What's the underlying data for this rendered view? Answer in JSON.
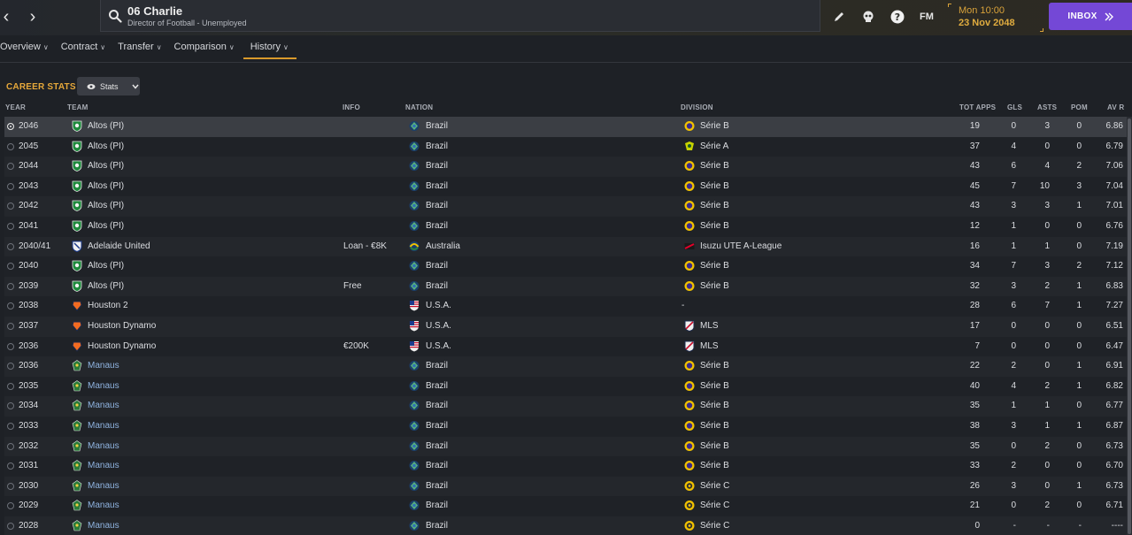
{
  "header": {
    "person_name": "06 Charlie",
    "person_role": "Director of Football - Unemployed",
    "time": "Mon 10:00",
    "date": "23 Nov 2048",
    "inbox_label": "INBOX",
    "fm_label": "FM"
  },
  "tabs": [
    {
      "label": "Overview"
    },
    {
      "label": "Contract"
    },
    {
      "label": "Transfer"
    },
    {
      "label": "Comparison"
    },
    {
      "label": "History",
      "active": true
    }
  ],
  "section": {
    "title": "CAREER STATS",
    "stats_button": "Stats"
  },
  "columns": {
    "year": "YEAR",
    "team": "TEAM",
    "info": "INFO",
    "nation": "NATION",
    "division": "DIVISION",
    "apps": "TOT APPS",
    "gls": "GLS",
    "asts": "ASTS",
    "pom": "POM",
    "avr": "AV R"
  },
  "colors": {
    "accent": "#e6a83a",
    "inbox": "#7448d6",
    "link": "#8fb3e0"
  },
  "rows": [
    {
      "year": "2046",
      "team": "Altos (PI)",
      "info": "",
      "nation": "Brazil",
      "division": "Série B",
      "apps": "19",
      "gls": "0",
      "asts": "3",
      "pom": "0",
      "avr": "6.86",
      "selected": true,
      "team_icon": "altos",
      "nation_icon": "brazil",
      "div_icon": "serie-b"
    },
    {
      "year": "2045",
      "team": "Altos (PI)",
      "info": "",
      "nation": "Brazil",
      "division": "Série A",
      "apps": "37",
      "gls": "4",
      "asts": "0",
      "pom": "0",
      "avr": "6.79",
      "team_icon": "altos",
      "nation_icon": "brazil",
      "div_icon": "serie-a"
    },
    {
      "year": "2044",
      "team": "Altos (PI)",
      "info": "",
      "nation": "Brazil",
      "division": "Série B",
      "apps": "43",
      "gls": "6",
      "asts": "4",
      "pom": "2",
      "avr": "7.06",
      "team_icon": "altos",
      "nation_icon": "brazil",
      "div_icon": "serie-b"
    },
    {
      "year": "2043",
      "team": "Altos (PI)",
      "info": "",
      "nation": "Brazil",
      "division": "Série B",
      "apps": "45",
      "gls": "7",
      "asts": "10",
      "pom": "3",
      "avr": "7.04",
      "team_icon": "altos",
      "nation_icon": "brazil",
      "div_icon": "serie-b"
    },
    {
      "year": "2042",
      "team": "Altos (PI)",
      "info": "",
      "nation": "Brazil",
      "division": "Série B",
      "apps": "43",
      "gls": "3",
      "asts": "3",
      "pom": "1",
      "avr": "7.01",
      "team_icon": "altos",
      "nation_icon": "brazil",
      "div_icon": "serie-b"
    },
    {
      "year": "2041",
      "team": "Altos (PI)",
      "info": "",
      "nation": "Brazil",
      "division": "Série B",
      "apps": "12",
      "gls": "1",
      "asts": "0",
      "pom": "0",
      "avr": "6.76",
      "team_icon": "altos",
      "nation_icon": "brazil",
      "div_icon": "serie-b"
    },
    {
      "year": "2040/41",
      "team": "Adelaide United",
      "info": "Loan - €8K",
      "nation": "Australia",
      "division": "Isuzu UTE A-League",
      "apps": "16",
      "gls": "1",
      "asts": "1",
      "pom": "0",
      "avr": "7.19",
      "team_icon": "adelaide",
      "nation_icon": "australia",
      "div_icon": "a-league"
    },
    {
      "year": "2040",
      "team": "Altos (PI)",
      "info": "",
      "nation": "Brazil",
      "division": "Série B",
      "apps": "34",
      "gls": "7",
      "asts": "3",
      "pom": "2",
      "avr": "7.12",
      "team_icon": "altos",
      "nation_icon": "brazil",
      "div_icon": "serie-b"
    },
    {
      "year": "2039",
      "team": "Altos (PI)",
      "info": "Free",
      "nation": "Brazil",
      "division": "Série B",
      "apps": "32",
      "gls": "3",
      "asts": "2",
      "pom": "1",
      "avr": "6.83",
      "team_icon": "altos",
      "nation_icon": "brazil",
      "div_icon": "serie-b"
    },
    {
      "year": "2038",
      "team": "Houston 2",
      "info": "",
      "nation": "U.S.A.",
      "division": "-",
      "apps": "28",
      "gls": "6",
      "asts": "7",
      "pom": "1",
      "avr": "7.27",
      "team_icon": "houston",
      "nation_icon": "usa",
      "div_icon": ""
    },
    {
      "year": "2037",
      "team": "Houston Dynamo",
      "info": "",
      "nation": "U.S.A.",
      "division": "MLS",
      "apps": "17",
      "gls": "0",
      "asts": "0",
      "pom": "0",
      "avr": "6.51",
      "team_icon": "houston",
      "nation_icon": "usa",
      "div_icon": "mls"
    },
    {
      "year": "2036",
      "team": "Houston Dynamo",
      "info": "€200K",
      "nation": "U.S.A.",
      "division": "MLS",
      "apps": "7",
      "gls": "0",
      "asts": "0",
      "pom": "0",
      "avr": "6.47",
      "team_icon": "houston",
      "nation_icon": "usa",
      "div_icon": "mls"
    },
    {
      "year": "2036",
      "team": "Manaus",
      "info": "",
      "nation": "Brazil",
      "division": "Série B",
      "apps": "22",
      "gls": "2",
      "asts": "0",
      "pom": "1",
      "avr": "6.91",
      "link": true,
      "team_icon": "manaus",
      "nation_icon": "brazil",
      "div_icon": "serie-b"
    },
    {
      "year": "2035",
      "team": "Manaus",
      "info": "",
      "nation": "Brazil",
      "division": "Série B",
      "apps": "40",
      "gls": "4",
      "asts": "2",
      "pom": "1",
      "avr": "6.82",
      "link": true,
      "team_icon": "manaus",
      "nation_icon": "brazil",
      "div_icon": "serie-b"
    },
    {
      "year": "2034",
      "team": "Manaus",
      "info": "",
      "nation": "Brazil",
      "division": "Série B",
      "apps": "35",
      "gls": "1",
      "asts": "1",
      "pom": "0",
      "avr": "6.77",
      "link": true,
      "team_icon": "manaus",
      "nation_icon": "brazil",
      "div_icon": "serie-b"
    },
    {
      "year": "2033",
      "team": "Manaus",
      "info": "",
      "nation": "Brazil",
      "division": "Série B",
      "apps": "38",
      "gls": "3",
      "asts": "1",
      "pom": "1",
      "avr": "6.87",
      "link": true,
      "team_icon": "manaus",
      "nation_icon": "brazil",
      "div_icon": "serie-b"
    },
    {
      "year": "2032",
      "team": "Manaus",
      "info": "",
      "nation": "Brazil",
      "division": "Série B",
      "apps": "35",
      "gls": "0",
      "asts": "2",
      "pom": "0",
      "avr": "6.73",
      "link": true,
      "team_icon": "manaus",
      "nation_icon": "brazil",
      "div_icon": "serie-b"
    },
    {
      "year": "2031",
      "team": "Manaus",
      "info": "",
      "nation": "Brazil",
      "division": "Série B",
      "apps": "33",
      "gls": "2",
      "asts": "0",
      "pom": "0",
      "avr": "6.70",
      "link": true,
      "team_icon": "manaus",
      "nation_icon": "brazil",
      "div_icon": "serie-b"
    },
    {
      "year": "2030",
      "team": "Manaus",
      "info": "",
      "nation": "Brazil",
      "division": "Série C",
      "apps": "26",
      "gls": "3",
      "asts": "0",
      "pom": "1",
      "avr": "6.73",
      "link": true,
      "team_icon": "manaus",
      "nation_icon": "brazil",
      "div_icon": "serie-c"
    },
    {
      "year": "2029",
      "team": "Manaus",
      "info": "",
      "nation": "Brazil",
      "division": "Série C",
      "apps": "21",
      "gls": "0",
      "asts": "2",
      "pom": "0",
      "avr": "6.71",
      "link": true,
      "team_icon": "manaus",
      "nation_icon": "brazil",
      "div_icon": "serie-c"
    },
    {
      "year": "2028",
      "team": "Manaus",
      "info": "",
      "nation": "Brazil",
      "division": "Série C",
      "apps": "0",
      "gls": "-",
      "asts": "-",
      "pom": "-",
      "avr": "----",
      "link": true,
      "team_icon": "manaus",
      "nation_icon": "brazil",
      "div_icon": "serie-c"
    }
  ]
}
